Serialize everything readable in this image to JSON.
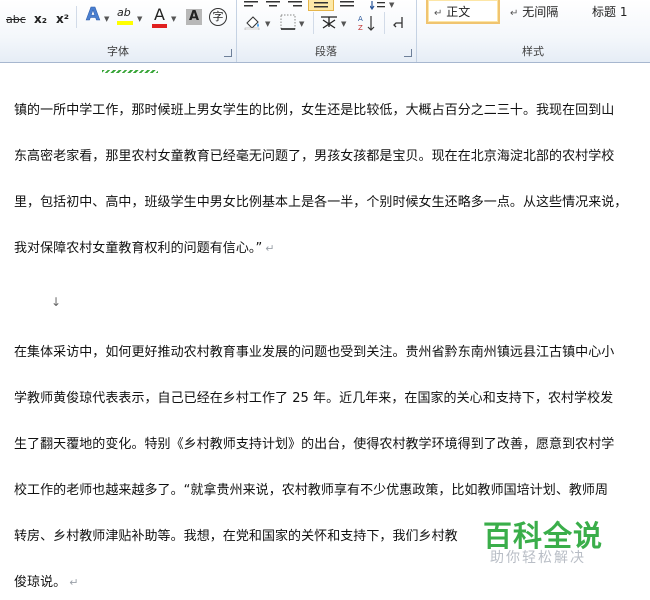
{
  "ribbon": {
    "font_group": {
      "label": "字体",
      "strike_label": "abc",
      "subscript_label": "x₂",
      "superscript_label": "x²",
      "text_effect_label": "A",
      "highlight_label": "ab",
      "font_color_label": "A",
      "char_shading_label": "A",
      "enclose_label": "字"
    },
    "paragraph_group": {
      "label": "段落"
    },
    "styles_group": {
      "label": "样式",
      "items": [
        {
          "label": "正文",
          "mark": "↵"
        },
        {
          "label": "无间隔",
          "mark": "↵"
        },
        {
          "label": "标题 1"
        }
      ]
    },
    "colors": {
      "highlight": "#ffff00",
      "font_color": "#e02020",
      "accent": "#2b579a"
    }
  },
  "document": {
    "lines": [
      "镇的一所中学工作，那时候班上男女学生的比例，女生还是比较低，大概占百分之二三十。我现在回到山",
      "东高密老家看，那里农村女童教育已经毫无问题了，男孩女孩都是宝贝。现在在北京海淀北部的农村学校",
      "里，包括初中、高中，班级学生中男女比例基本上是各一半，个别时候女生还略多一点。从这些情况来说，",
      "我对保障农村女童教育权利的问题有信心。”",
      "在集体采访中，如何更好推动农村教育事业发展的问题也受到关注。贵州省黔东南州镇远县江古镇中心小",
      "学教师黄俊琼代表表示，自己已经在乡村工作了 25 年。近几年来，在国家的关心和支持下，农村学校发",
      "生了翻天覆地的变化。特别《乡村教师支持计划》的出台，使得农村教学环境得到了改善，愿意到农村学",
      "校工作的老师也越来越多了。“就拿贵州来说，农村教师享有不少优惠政策，比如教师国培计划、教师周",
      "转房、乡村教师津贴补助等。我想，在党和国家的关怀和支持下，我们乡村教",
      "俊琼说。"
    ],
    "paragraph_mark": "↵",
    "empty_para_mark": "↓"
  },
  "watermark": {
    "title": "百科全说",
    "subtitle": "助你轻松解决"
  }
}
